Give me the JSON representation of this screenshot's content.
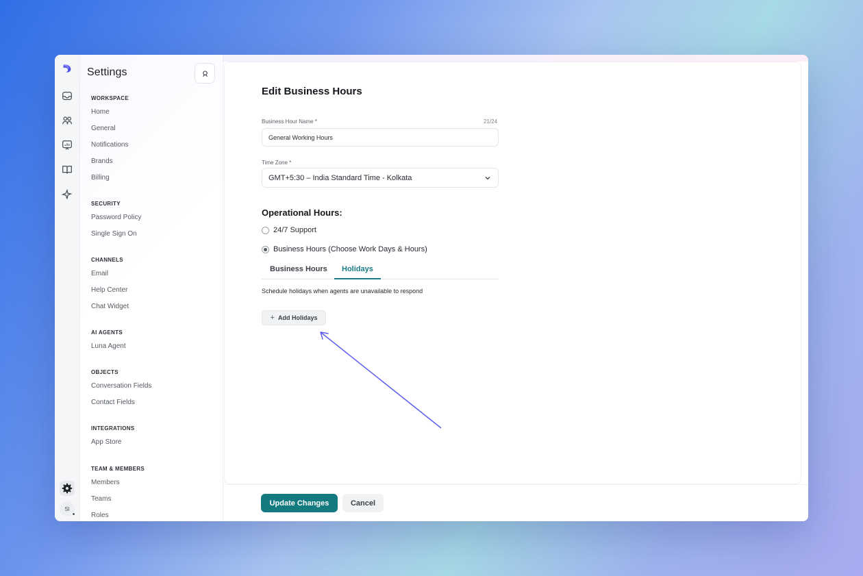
{
  "sidebar": {
    "title": "Settings",
    "sections": [
      {
        "title": "WORKSPACE",
        "items": [
          "Home",
          "General",
          "Notifications",
          "Brands",
          "Billing"
        ]
      },
      {
        "title": "SECURITY",
        "items": [
          "Password Policy",
          "Single Sign On"
        ]
      },
      {
        "title": "CHANNELS",
        "items": [
          "Email",
          "Help Center",
          "Chat Widget"
        ]
      },
      {
        "title": "AI AGENTS",
        "items": [
          "Luna Agent"
        ]
      },
      {
        "title": "OBJECTS",
        "items": [
          "Conversation Fields",
          "Contact Fields"
        ]
      },
      {
        "title": "INTEGRATIONS",
        "items": [
          "App Store"
        ]
      },
      {
        "title": "TEAM & MEMBERS",
        "items": [
          "Members",
          "Teams",
          "Roles"
        ]
      }
    ]
  },
  "rail": {
    "avatar_initials": "SI",
    "icons": [
      "logo-icon",
      "inbox-icon",
      "contacts-icon",
      "reports-icon",
      "knowledge-book-icon",
      "ai-sparkle-icon",
      "settings-gear-icon"
    ]
  },
  "form": {
    "heading": "Edit Business Hours",
    "name_label": "Business Hour Name *",
    "name_counter": "21/24",
    "name_value": "General Working Hours",
    "timezone_label": "Time Zone *",
    "timezone_value": "GMT+5:30 – India Standard Time - Kolkata",
    "operational_heading": "Operational Hours:",
    "option_247": "24/7 Support",
    "option_business": "Business Hours (Choose Work Days & Hours)",
    "selected_option": "Business Hours (Choose Work Days & Hours)",
    "tabs": [
      "Business Hours",
      "Holidays"
    ],
    "active_tab": "Holidays",
    "holidays_description": "Schedule holidays when agents are unavailable to respond",
    "add_holidays_label": "Add Holidays"
  },
  "footer": {
    "update_label": "Update Changes",
    "cancel_label": "Cancel"
  },
  "colors": {
    "accent": "#137a80",
    "tab_active": "#197a86",
    "annotation_arrow": "#5b5ef0"
  }
}
